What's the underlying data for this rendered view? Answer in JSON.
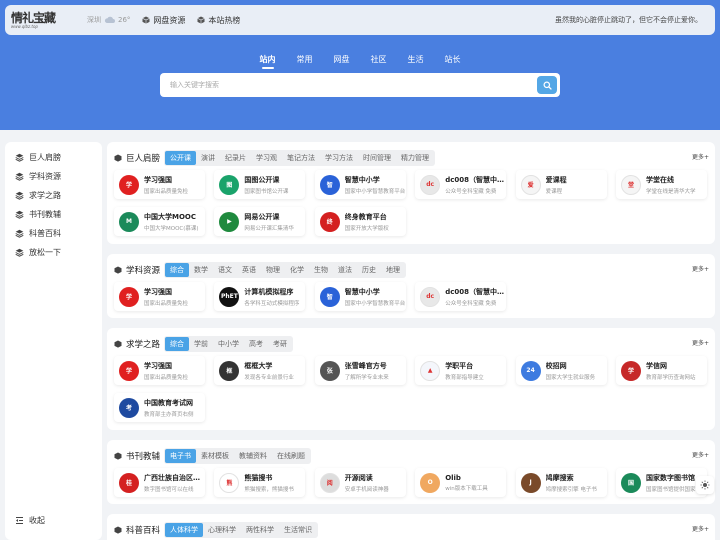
{
  "header": {
    "logo_text": "情礼宝藏",
    "logo_sub": "www.qlbz.top",
    "weather_city": "深圳",
    "weather_temp": "26°",
    "links": [
      "网盘资源",
      "本站热榜"
    ],
    "motto": "虽然我的心脏停止跳动了，但它不会停止爱你。"
  },
  "main_tabs": [
    "站内",
    "常用",
    "网盘",
    "社区",
    "生活",
    "站长"
  ],
  "active_tab": "站内",
  "search": {
    "placeholder": "输入关键字搜索"
  },
  "sidebar": {
    "items": [
      "巨人肩膀",
      "学科资源",
      "求学之路",
      "书刊教辅",
      "科普百科",
      "放松一下"
    ],
    "collapse": "收起"
  },
  "more_label": "更多+",
  "sections": [
    {
      "title": "巨人肩膀",
      "tabs": [
        "公开课",
        "演讲",
        "纪录片",
        "学习观",
        "笔记方法",
        "学习方法",
        "时间管理",
        "精力管理"
      ],
      "cards": [
        {
          "title": "学习强国",
          "desc": "国家出品质量免检",
          "icon_color": "#e02020",
          "glyph": "学"
        },
        {
          "title": "国图公开课",
          "desc": "国家图书馆公开课",
          "icon_color": "#1aa36b",
          "glyph": "图"
        },
        {
          "title": "智慧中小学",
          "desc": "国家中小学智慧教育平台",
          "icon_color": "#2a62d8",
          "glyph": "智"
        },
        {
          "title": "dc008（智慧中小学）",
          "desc": "公众号全科宝藏 免费",
          "icon_color": "#e8e8e8",
          "glyph": "dc"
        },
        {
          "title": "爱课程",
          "desc": "爱课程",
          "icon_color": "#f5f5f5",
          "glyph": "爱"
        },
        {
          "title": "学堂在线",
          "desc": "学堂在线是清华大学",
          "icon_color": "#f5f5f5",
          "glyph": "堂"
        },
        {
          "title": "中国大学MOOC",
          "desc": "中国大学MOOC(慕课)",
          "icon_color": "#1b8a5a",
          "glyph": "M"
        },
        {
          "title": "网易公开课",
          "desc": "网易公开课汇集清华",
          "icon_color": "#1f8a3e",
          "glyph": "▶"
        },
        {
          "title": "终身教育平台",
          "desc": "国家开放大学版权",
          "icon_color": "#d42020",
          "glyph": "终"
        }
      ]
    },
    {
      "title": "学科资源",
      "tabs": [
        "综合",
        "数学",
        "语文",
        "英语",
        "物理",
        "化学",
        "生物",
        "道法",
        "历史",
        "地理"
      ],
      "cards": [
        {
          "title": "学习强国",
          "desc": "国家出品质量免检",
          "icon_color": "#e02020",
          "glyph": "学"
        },
        {
          "title": "计算机模拟程序",
          "desc": "各学科互动式模拟程序",
          "icon_color": "#111111",
          "glyph": "PhET"
        },
        {
          "title": "智慧中小学",
          "desc": "国家中小学智慧教育平台",
          "icon_color": "#2a62d8",
          "glyph": "智"
        },
        {
          "title": "dc008（智慧中小学）",
          "desc": "公众号全科宝藏 免费",
          "icon_color": "#e8e8e8",
          "glyph": "dc"
        }
      ]
    },
    {
      "title": "求学之路",
      "tabs": [
        "综合",
        "学前",
        "中小学",
        "高考",
        "考研"
      ],
      "cards": [
        {
          "title": "学习强国",
          "desc": "国家出品质量免检",
          "icon_color": "#e02020",
          "glyph": "学"
        },
        {
          "title": "框框大学",
          "desc": "发现各专业前景行业",
          "icon_color": "#333333",
          "glyph": "框"
        },
        {
          "title": "张雪峰官方号",
          "desc": "了解所学专业未来",
          "icon_color": "#555555",
          "glyph": "张"
        },
        {
          "title": "学职平台",
          "desc": "教育部指导建立",
          "icon_color": "#f4f6fb",
          "glyph": "▲"
        },
        {
          "title": "校招网",
          "desc": "国家大学生就业服务",
          "icon_color": "#3d7be0",
          "glyph": "24"
        },
        {
          "title": "学信网",
          "desc": "教育部学历查询网站",
          "icon_color": "#c62828",
          "glyph": "学"
        },
        {
          "title": "中国教育考试网",
          "desc": "教育部主办首页右侧",
          "icon_color": "#1e4aa0",
          "glyph": "考"
        }
      ]
    },
    {
      "title": "书刊教辅",
      "tabs": [
        "电子书",
        "素材模板",
        "教辅资料",
        "在线刷题"
      ],
      "cards": [
        {
          "title": "广西壮族自治区图书馆",
          "desc": "数字图书馆可以在线",
          "icon_color": "#d42020",
          "glyph": "桂"
        },
        {
          "title": "熊猫搜书",
          "desc": "熊猫搜索，熊猫搜书",
          "icon_color": "#ffffff",
          "glyph": "熊"
        },
        {
          "title": "开源阅读",
          "desc": "安卓手机阅读神器",
          "icon_color": "#dddddd",
          "glyph": "阅"
        },
        {
          "title": "Olib",
          "desc": "win版本下载工具",
          "icon_color": "#f0a860",
          "glyph": "O"
        },
        {
          "title": "鸠摩搜索",
          "desc": "鸠摩搜索引擎 电子书",
          "icon_color": "#7a4a2a",
          "glyph": "J"
        },
        {
          "title": "国家数字图书馆",
          "desc": "国家图书馆提供国家",
          "icon_color": "#1b8a5a",
          "glyph": "国"
        }
      ]
    },
    {
      "title": "科普百科",
      "tabs": [
        "人体科学",
        "心理科学",
        "两性科学",
        "生活常识"
      ],
      "cards": []
    }
  ]
}
